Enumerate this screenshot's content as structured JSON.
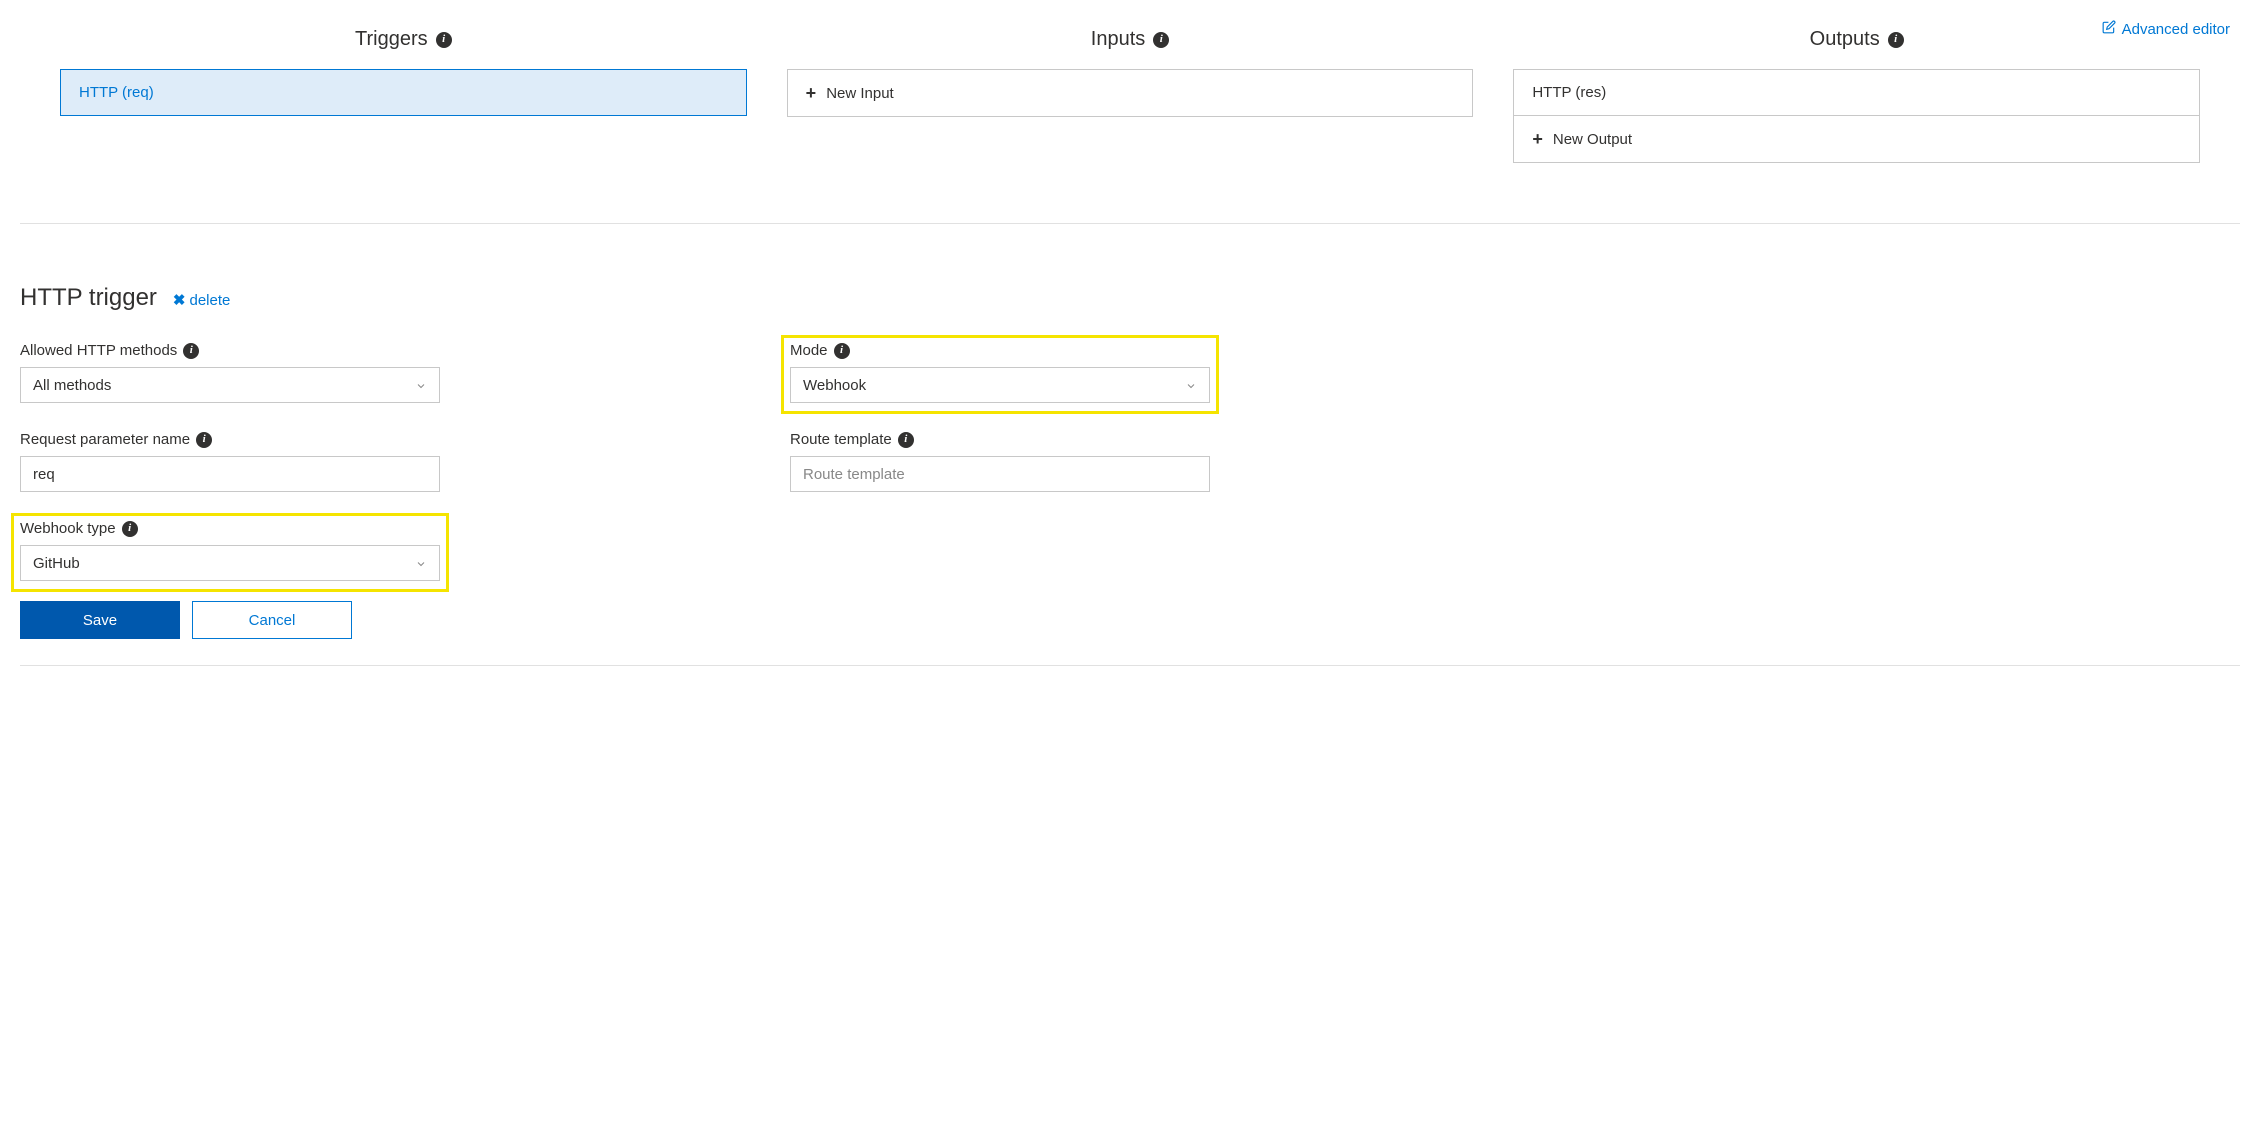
{
  "advanced_editor_label": "Advanced editor",
  "columns": {
    "triggers": {
      "header": "Triggers",
      "selected_item": "HTTP (req)"
    },
    "inputs": {
      "header": "Inputs",
      "new_label": "New Input"
    },
    "outputs": {
      "header": "Outputs",
      "item": "HTTP (res)",
      "new_label": "New Output"
    }
  },
  "detail": {
    "title": "HTTP trigger",
    "delete_label": "delete",
    "fields": {
      "allowed_methods": {
        "label": "Allowed HTTP methods",
        "value": "All methods"
      },
      "mode": {
        "label": "Mode",
        "value": "Webhook"
      },
      "request_param": {
        "label": "Request parameter name",
        "value": "req"
      },
      "route_template": {
        "label": "Route template",
        "placeholder": "Route template",
        "value": ""
      },
      "webhook_type": {
        "label": "Webhook type",
        "value": "GitHub"
      }
    },
    "buttons": {
      "save": "Save",
      "cancel": "Cancel"
    }
  }
}
